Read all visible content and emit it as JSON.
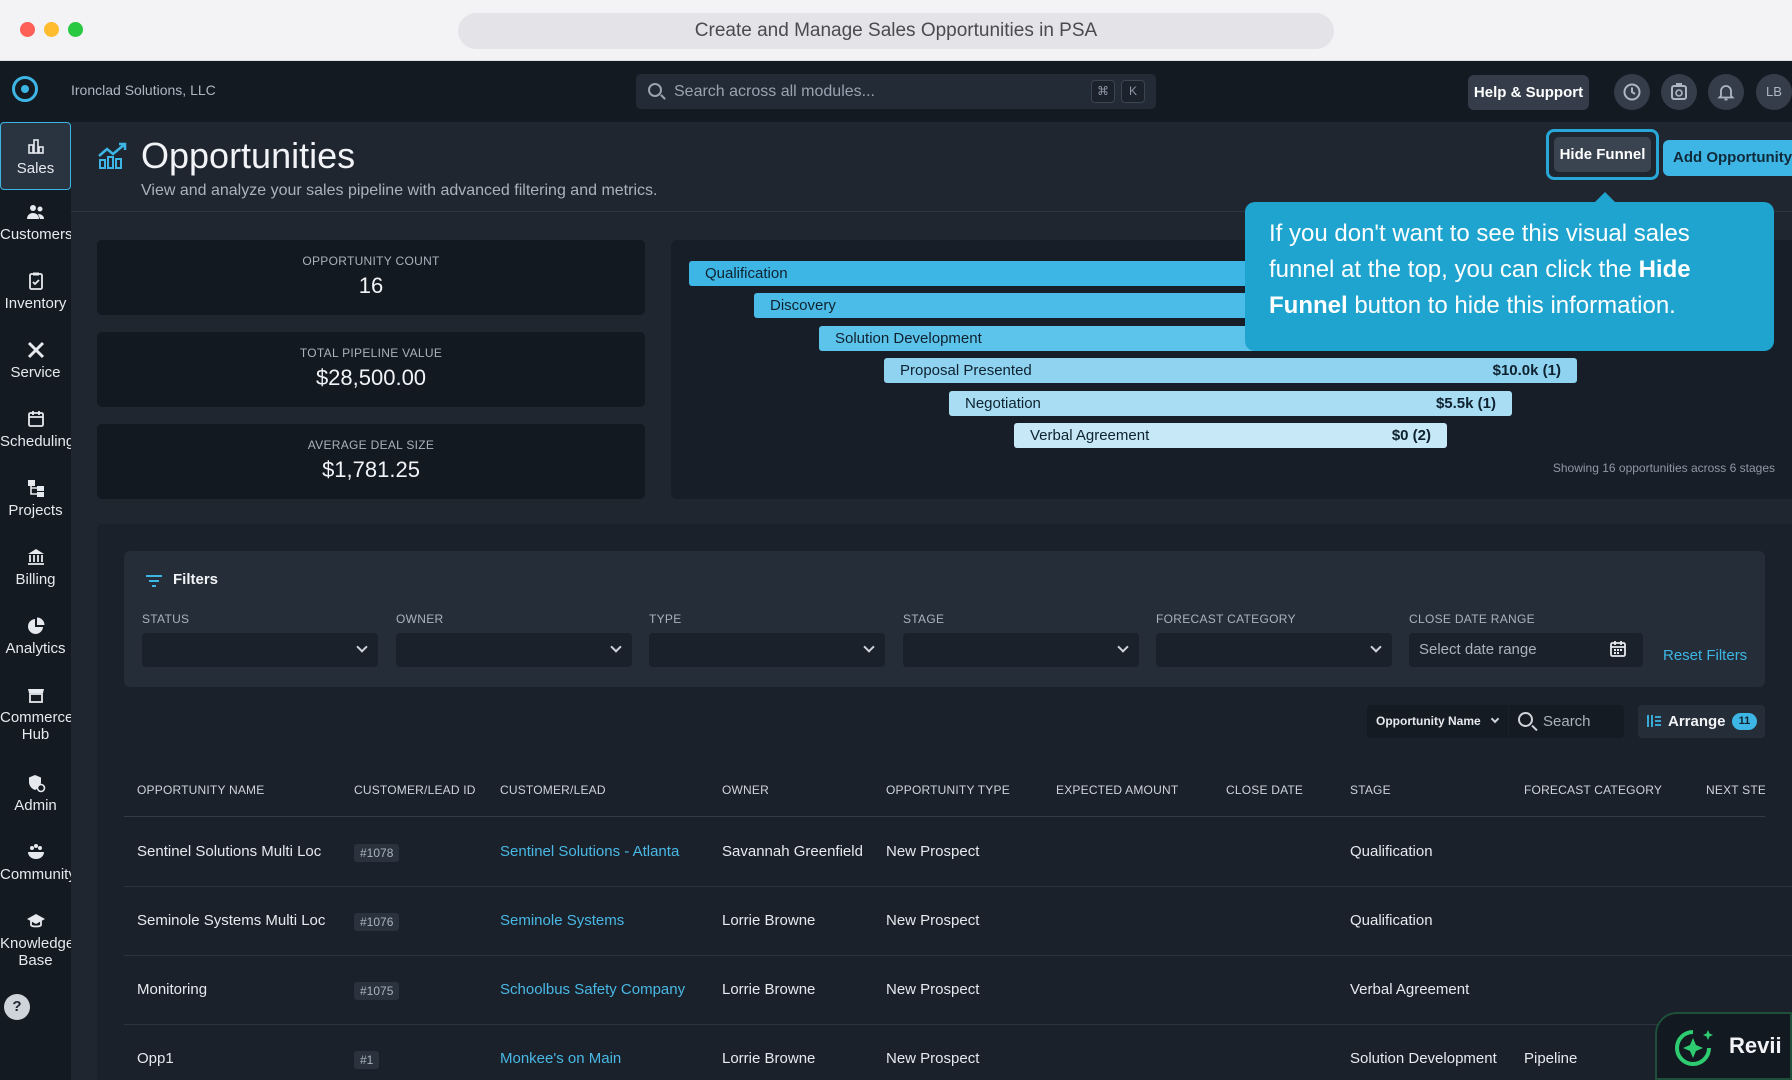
{
  "browser": {
    "title": "Create and Manage Sales Opportunities in PSA"
  },
  "topbar": {
    "company": "Ironclad Solutions, LLC",
    "search_placeholder": "Search across all modules...",
    "kbd_cmd": "⌘",
    "kbd_k": "K",
    "help_label": "Help & Support",
    "avatar_initials": "LB"
  },
  "sidebar": {
    "items": [
      {
        "label": "Sales",
        "icon": "bar-chart-icon"
      },
      {
        "label": "Customers",
        "icon": "users-icon"
      },
      {
        "label": "Inventory",
        "icon": "clipboard-icon"
      },
      {
        "label": "Service",
        "icon": "tools-icon"
      },
      {
        "label": "Scheduling",
        "icon": "calendar-icon"
      },
      {
        "label": "Projects",
        "icon": "hierarchy-icon"
      },
      {
        "label": "Billing",
        "icon": "bank-icon"
      },
      {
        "label": "Analytics",
        "icon": "pie-chart-icon"
      },
      {
        "label": "Commerce",
        "label2": "Hub",
        "icon": "store-icon"
      },
      {
        "label": "Admin",
        "icon": "admin-shield-icon"
      },
      {
        "label": "Community",
        "icon": "community-icon"
      },
      {
        "label": "Knowledge",
        "label2": "Base",
        "icon": "graduation-cap-icon"
      }
    ],
    "help": "?"
  },
  "page": {
    "title": "Opportunities",
    "subtitle": "View and analyze your sales pipeline with advanced filtering and metrics.",
    "hide_funnel": "Hide Funnel",
    "add_opportunity": "Add Opportunity"
  },
  "metrics": [
    {
      "label": "OPPORTUNITY COUNT",
      "value": "16"
    },
    {
      "label": "TOTAL PIPELINE VALUE",
      "value": "$28,500.00"
    },
    {
      "label": "AVERAGE DEAL SIZE",
      "value": "$1,781.25"
    }
  ],
  "funnel": {
    "stages": [
      {
        "name": "Qualification",
        "value": "",
        "color": "#3db6e5"
      },
      {
        "name": "Discovery",
        "value": "",
        "color": "#4bbce7"
      },
      {
        "name": "Solution Development",
        "value": "",
        "color": "#5cc3ea"
      },
      {
        "name": "Proposal Presented",
        "value": "$10.0k (1)",
        "color": "#8fd3f0"
      },
      {
        "name": "Negotiation",
        "value": "$5.5k (1)",
        "color": "#a9ddf3"
      },
      {
        "name": "Verbal Agreement",
        "value": "$0 (2)",
        "color": "#c6e8f7"
      }
    ],
    "note": "Showing 16 opportunities across 6 stages"
  },
  "tooltip": {
    "part1": "If you don't want to see this visual sales funnel at the top, you can click the ",
    "bold1": "Hide Funnel",
    "part2": " button to hide this information."
  },
  "filters": {
    "title": "Filters",
    "fields": [
      {
        "label": "STATUS",
        "value": ""
      },
      {
        "label": "OWNER",
        "value": ""
      },
      {
        "label": "TYPE",
        "value": ""
      },
      {
        "label": "STAGE",
        "value": ""
      },
      {
        "label": "FORECAST CATEGORY",
        "value": ""
      }
    ],
    "date_label": "CLOSE DATE RANGE",
    "date_placeholder": "Select date range",
    "reset": "Reset Filters"
  },
  "toolbar": {
    "search_field": "Opportunity Name",
    "search_placeholder": "Search",
    "arrange": "Arrange",
    "arrange_count": "11"
  },
  "table": {
    "columns": [
      "OPPORTUNITY NAME",
      "CUSTOMER/LEAD ID",
      "CUSTOMER/LEAD",
      "OWNER",
      "OPPORTUNITY TYPE",
      "EXPECTED AMOUNT",
      "CLOSE DATE",
      "STAGE",
      "FORECAST CATEGORY",
      "NEXT STEP"
    ],
    "rows": [
      {
        "name": "Sentinel Solutions Multi Loc",
        "id": "#1078",
        "customer": "Sentinel Solutions - Atlanta",
        "owner": "Savannah Greenfield",
        "type": "New Prospect",
        "amount": "",
        "close": "",
        "stage": "Qualification",
        "forecast": "",
        "next": ""
      },
      {
        "name": "Seminole Systems Multi Loc",
        "id": "#1076",
        "customer": "Seminole Systems",
        "owner": "Lorrie Browne",
        "type": "New Prospect",
        "amount": "",
        "close": "",
        "stage": "Qualification",
        "forecast": "",
        "next": ""
      },
      {
        "name": "Monitoring",
        "id": "#1075",
        "customer": "Schoolbus Safety Company",
        "owner": "Lorrie Browne",
        "type": "New Prospect",
        "amount": "",
        "close": "",
        "stage": "Verbal Agreement",
        "forecast": "",
        "next": ""
      },
      {
        "name": "Opp1",
        "id": "#1",
        "customer": "Monkee's on Main",
        "owner": "Lorrie Browne",
        "type": "New Prospect",
        "amount": "",
        "close": "",
        "stage": "Solution Development",
        "forecast": "Pipeline",
        "next": ""
      }
    ]
  },
  "assistant": {
    "label": "Revii"
  }
}
